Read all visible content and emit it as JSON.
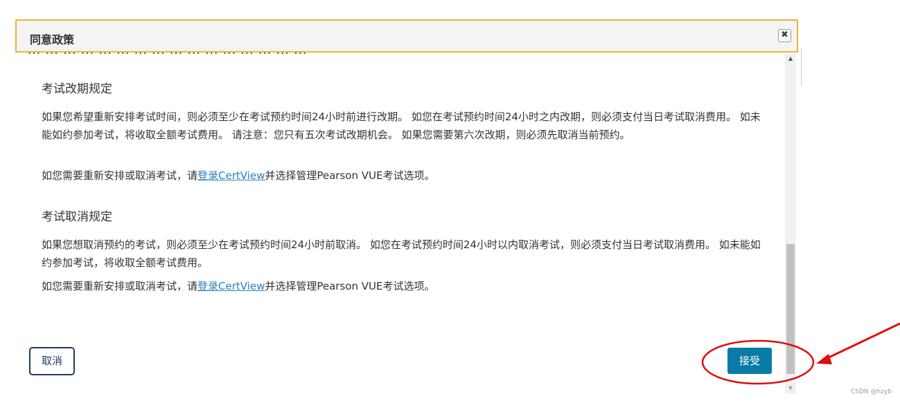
{
  "dialog": {
    "title": "同意政策",
    "close_icon": "close-icon",
    "clipped_text": "... ... ... ... ... ... ... ... ... ... ... ... ... ... ... ..."
  },
  "sections": [
    {
      "title": "考试改期规定",
      "paragraph": "如果您希望重新安排考试时间，则必须至少在考试预约时间24小时前进行改期。 如您在考试预约时间24小时之内改期，则必须支付当日考试取消费用。 如未能如约参加考试，将收取全额考试费用。 请注意：您只有五次考试改期机会。 如果您需要第六次改期，则必须先取消当前预约。",
      "link_prefix": "如您需要重新安排或取消考试，请",
      "link_text": "登录CertView",
      "link_suffix": "并选择管理Pearson VUE考试选项。"
    },
    {
      "title": "考试取消规定",
      "paragraph": "如果您想取消预约的考试，则必须至少在考试预约时间24小时前取消。 如您在考试预约时间24小时以内取消考试，则必须支付当日考试取消费用。 如未能如约参加考试，将收取全额考试费用。",
      "link_prefix": "如您需要重新安排或取消考试，请",
      "link_text": "登录CertView",
      "link_suffix": "并选择管理Pearson VUE考试选项。"
    }
  ],
  "footer": {
    "cancel_label": "取消",
    "accept_label": "接受"
  },
  "watermark": "CSDN @hzyb",
  "colors": {
    "header_border": "#e8b634",
    "accept_bg": "#0a7aa6",
    "cancel_border": "#1f3b5a",
    "link": "#2a7fb8",
    "annotation": "#e30b0b"
  }
}
